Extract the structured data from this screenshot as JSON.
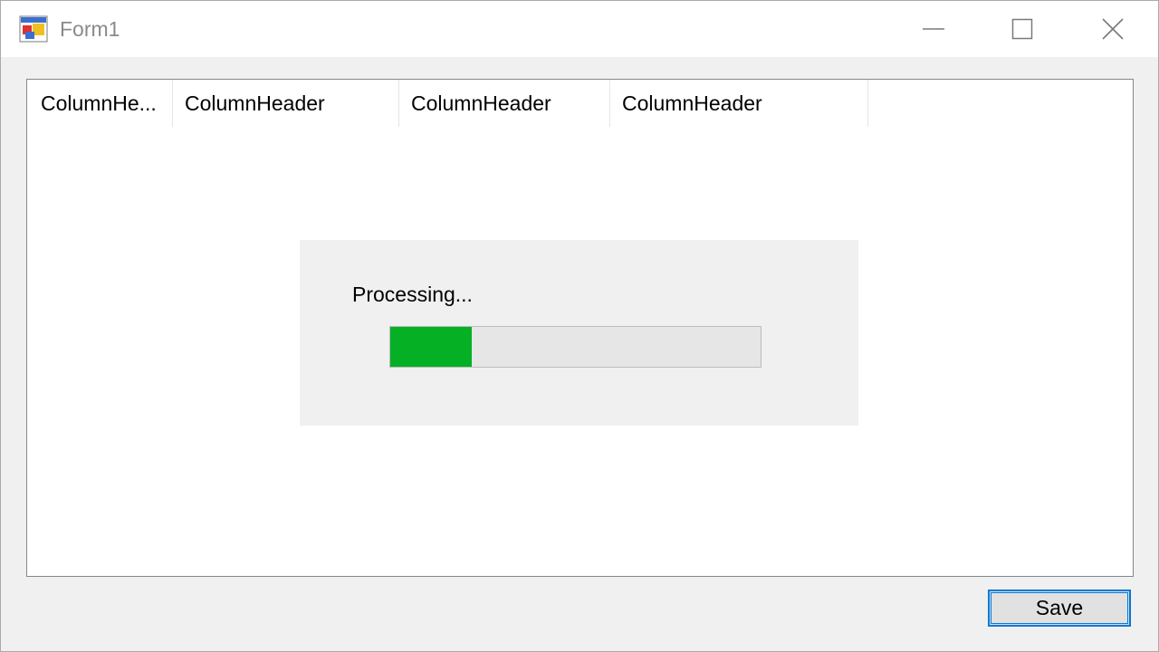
{
  "window": {
    "title": "Form1",
    "icon": "winforms-app-icon",
    "controls": {
      "minimize_icon": "minimize-icon",
      "maximize_icon": "maximize-icon",
      "close_icon": "close-icon"
    }
  },
  "listview": {
    "columns": [
      {
        "label": "ColumnHe..."
      },
      {
        "label": "ColumnHeader"
      },
      {
        "label": "ColumnHeader"
      },
      {
        "label": "ColumnHeader"
      }
    ]
  },
  "progress": {
    "label": "Processing...",
    "fraction": 0.22,
    "fill_color": "#06b025",
    "track_color": "#e6e6e6"
  },
  "footer": {
    "save_label": "Save",
    "accent_color": "#0078d7"
  }
}
